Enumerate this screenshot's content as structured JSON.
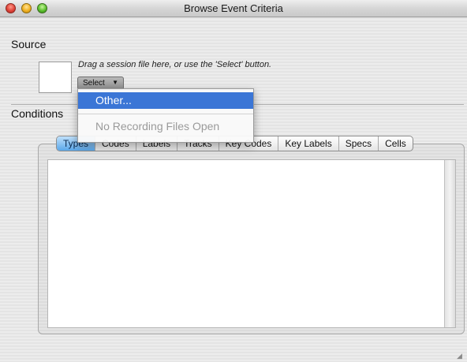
{
  "window": {
    "title": "Browse Event Criteria"
  },
  "source": {
    "label": "Source",
    "hint": "Drag a session file here, or use the 'Select' button.",
    "select_label": "Select",
    "select_arrow": "▼"
  },
  "menu": {
    "highlighted": "Other...",
    "disabled": "No Recording Files Open"
  },
  "conditions": {
    "label": "Conditions",
    "tabs": [
      "Types",
      "Codes",
      "Labels",
      "Tracks",
      "Key Codes",
      "Key Labels",
      "Specs",
      "Cells"
    ],
    "selected_tab": "Types"
  },
  "icons": {
    "window_controls": [
      "close-icon",
      "minimize-icon",
      "zoom-icon"
    ],
    "resize": "resize-grip-icon"
  },
  "colors": {
    "menu_highlight": "#3b76d6",
    "tab_selected": "#5aa7ea"
  }
}
